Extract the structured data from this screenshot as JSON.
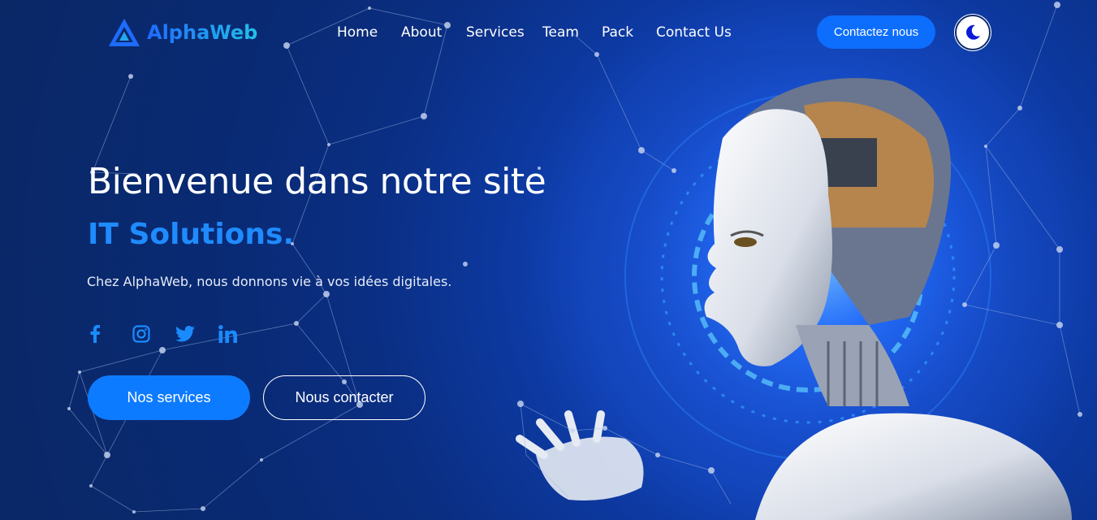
{
  "brand": {
    "name": "AlphaWeb"
  },
  "nav": {
    "items": [
      "Home",
      "About",
      "Services",
      "Team",
      "Pack",
      "Contact Us"
    ]
  },
  "header": {
    "contact_button": "Contactez nous",
    "theme_toggle_icon": "moon-icon"
  },
  "hero": {
    "title": "Bienvenue dans notre site",
    "subtitle": "IT Solutions.",
    "text": "Chez AlphaWeb, nous donnons vie à vos idées digitales.",
    "socials": [
      "facebook-icon",
      "instagram-icon",
      "twitter-icon",
      "linkedin-icon"
    ],
    "primary_button": "Nos services",
    "secondary_button": "Nous contacter"
  },
  "colors": {
    "background": "#0a2a6b",
    "accent": "#0d6efd",
    "subtitle": "#1f8bff"
  }
}
